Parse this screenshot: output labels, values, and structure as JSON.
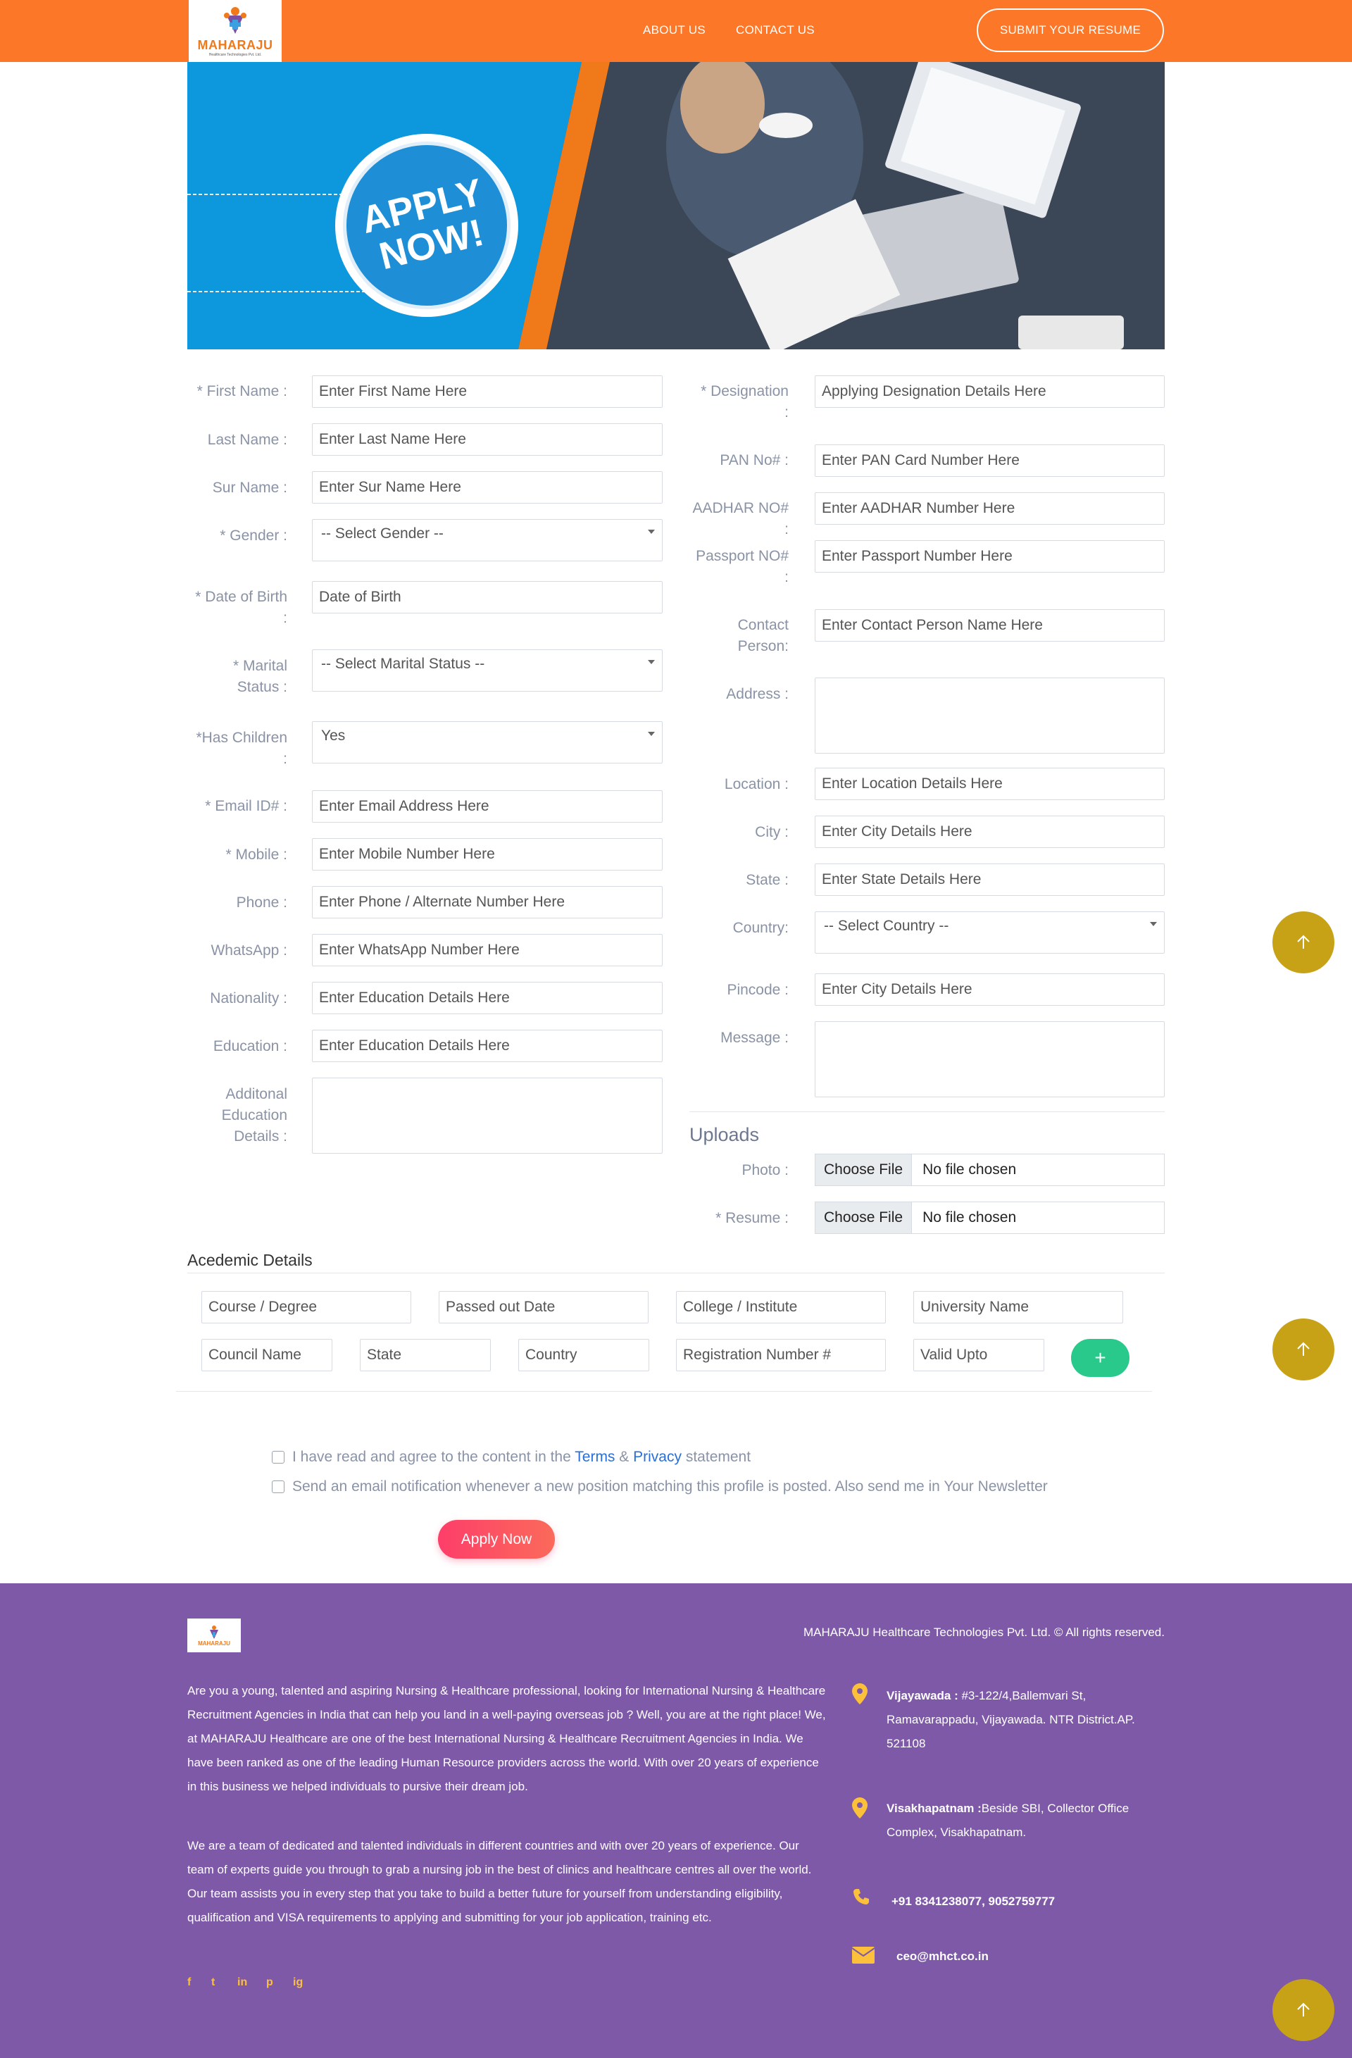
{
  "header": {
    "logo_text": "MAHARAJU",
    "logo_sub": "Healthcare Technologies Pvt. Ltd.",
    "nav": [
      "ABOUT US",
      "CONTACT US"
    ],
    "submit_resume": "SUBMIT YOUR RESUME"
  },
  "banner": {
    "badge_line1": "APPLY",
    "badge_line2": "NOW!"
  },
  "form_left": {
    "first_name": {
      "label": "* First Name :",
      "placeholder": "Enter First Name Here"
    },
    "last_name": {
      "label": "Last Name :",
      "placeholder": "Enter Last Name Here"
    },
    "sur_name": {
      "label": "Sur Name :",
      "placeholder": "Enter Sur Name Here"
    },
    "gender": {
      "label": "* Gender :",
      "value": "-- Select Gender --"
    },
    "dob": {
      "label_1": "* Date of Birth",
      "label_2": ":",
      "placeholder": "Date of Birth"
    },
    "marital": {
      "label_1": "* Marital",
      "label_2": "Status :",
      "value": "-- Select Marital Status --"
    },
    "children": {
      "label_1": "*Has Children",
      "label_2": ":",
      "value": "Yes"
    },
    "email": {
      "label": "* Email ID# :",
      "placeholder": "Enter Email Address Here"
    },
    "mobile": {
      "label": "* Mobile :",
      "placeholder": "Enter Mobile Number Here"
    },
    "phone": {
      "label": "Phone :",
      "placeholder": "Enter Phone / Alternate Number Here"
    },
    "whatsapp": {
      "label": "WhatsApp :",
      "placeholder": "Enter WhatsApp Number Here"
    },
    "nationality": {
      "label": "Nationality :",
      "placeholder": "Enter Education Details Here"
    },
    "education": {
      "label": "Education :",
      "placeholder": "Enter Education Details Here"
    },
    "additional": {
      "label_1": "Additonal",
      "label_2": "Education",
      "label_3": "Details :"
    }
  },
  "form_right": {
    "designation": {
      "label_1": "* Designation",
      "label_2": ":",
      "placeholder": "Applying Designation Details Here"
    },
    "pan": {
      "label": "PAN No# :",
      "placeholder": "Enter PAN Card Number Here"
    },
    "aadhar": {
      "label": "AADHAR NO# :",
      "placeholder": "Enter AADHAR Number Here"
    },
    "passport": {
      "label_1": "Passport NO#",
      "label_2": ":",
      "placeholder": "Enter Passport Number Here"
    },
    "contact_person": {
      "label_1": "Contact",
      "label_2": "Person:",
      "placeholder": "Enter  Contact Person Name Here"
    },
    "address": {
      "label": "Address :"
    },
    "location": {
      "label": "Location :",
      "placeholder": "Enter Location Details Here"
    },
    "city": {
      "label": "City :",
      "placeholder": "Enter City Details Here"
    },
    "state": {
      "label": "State :",
      "placeholder": "Enter State Details Here"
    },
    "country": {
      "label": "Country:",
      "value": "-- Select Country --"
    },
    "pincode": {
      "label": "Pincode :",
      "placeholder": "Enter City Details Here"
    },
    "message": {
      "label": "Message :"
    }
  },
  "uploads": {
    "title": "Uploads",
    "photo_label": "Photo :",
    "resume_label": "* Resume :",
    "choose": "Choose File",
    "no_file": "No file chosen"
  },
  "academic": {
    "title": "Acedemic Details",
    "row1": [
      "Course / Degree",
      "Passed out Date",
      "College / Institute",
      "University Name"
    ],
    "row2": [
      "Council Name",
      "State",
      "Country",
      "Registration Number #",
      "Valid Upto"
    ],
    "add": "+"
  },
  "agreement": {
    "terms_pre": "I have read and agree to the content in the",
    "terms_link": "Terms",
    "amp": "&",
    "privacy_link": "Privacy",
    "terms_post": "statement",
    "newsletter": "Send an email notification whenever a new position matching this profile is posted. Also send me in Your Newsletter",
    "apply": "Apply Now"
  },
  "footer": {
    "copyright": "MAHARAJU Healthcare Technologies Pvt. Ltd. © All rights reserved.",
    "about_1": "Are you a young, talented and aspiring Nursing & Healthcare professional, looking for International Nursing & Healthcare Recruitment Agencies in India that can help you land in a well-paying overseas job ? Well, you are at the right place! We, at MAHARAJU Healthcare are one of the best International Nursing & Healthcare Recruitment Agencies in India. We have been ranked as one of the leading Human Resource providers across the world. With over 20 years of experience in this business we helped individuals to pursive their dream job.",
    "about_2": "We are a team of dedicated and talented individuals in different countries and with over 20 years of experience. Our team of experts guide you through to grab a nursing job in the best of clinics and healthcare centres all over the world. Our team assists you in every step that you take to build a better future for yourself from understanding eligibility, qualification and VISA requirements to applying and submitting for your job application, training etc.",
    "vijayawada_label": "Vijayawada :",
    "vijayawada_addr": " #3-122/4,Ballemvari St, Ramavarappadu, Vijayawada. NTR District.AP. 521108",
    "vizag_label": "Visakhapatnam :",
    "vizag_addr": "Beside SBI, Collector Office Complex, Visakhapatnam.",
    "phone": "+91 8341238077, 9052759777",
    "email": "ceo@mhct.co.in",
    "social": [
      "f",
      "t",
      "in",
      "p",
      "ig"
    ]
  },
  "colors": {
    "brand_orange": "#fd7728",
    "footer_purple": "#7d59a7",
    "accent_gold": "#c7a216",
    "add_green": "#29c98c",
    "apply_pink": "#fd3e6a"
  }
}
